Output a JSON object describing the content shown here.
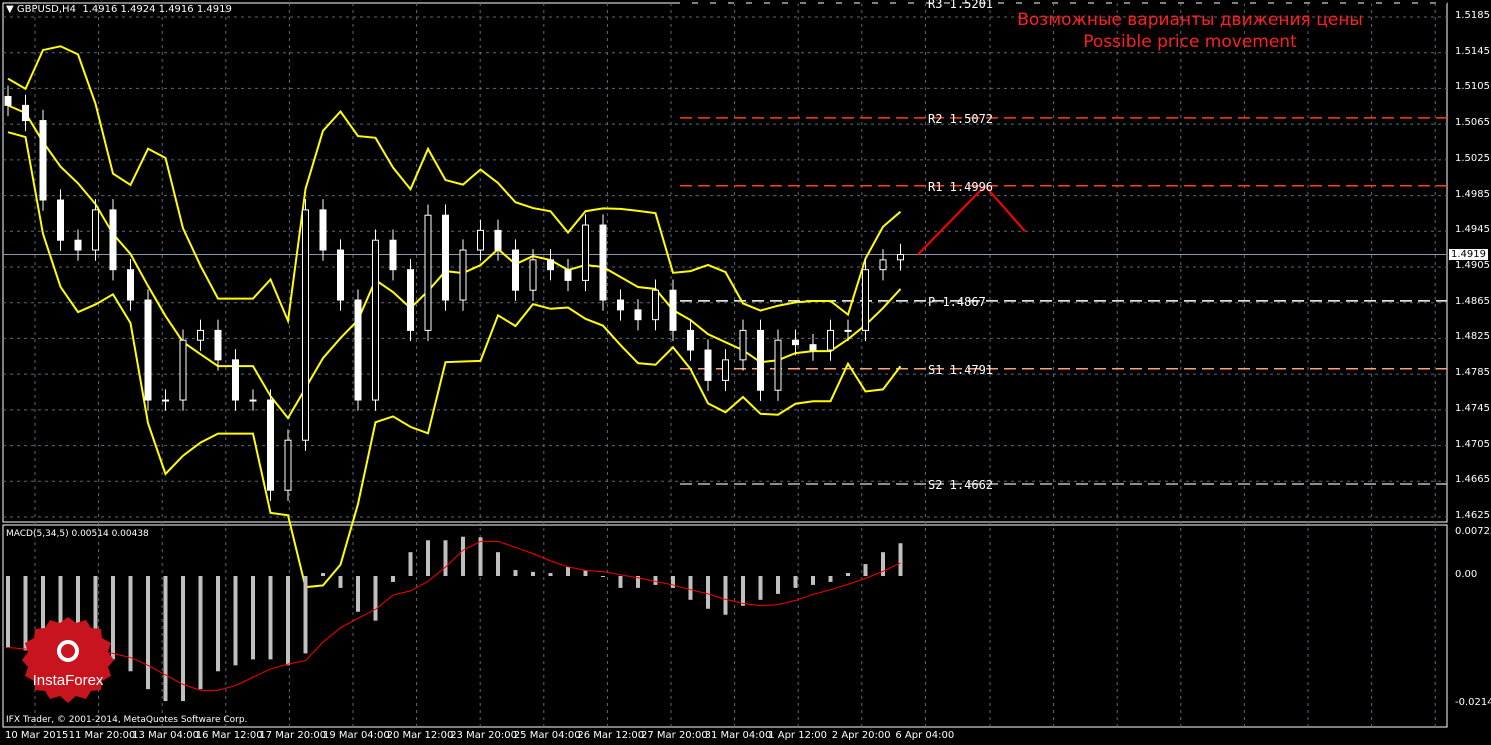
{
  "header": {
    "symbol_label": "GBPUSD,H4",
    "ohlc": "1.4916 1.4924 1.4916 1.4919"
  },
  "annotation": {
    "line1": "Возможные варианты движения цены",
    "line2": "Possible price movement"
  },
  "pivots": [
    {
      "label": "R3",
      "value": 1.5201,
      "text": "R3 1.5201",
      "color": "#000000"
    },
    {
      "label": "R2",
      "value": 1.5072,
      "text": "R2 1.5072",
      "color": "#ff4010"
    },
    {
      "label": "R1",
      "value": 1.4996,
      "text": "R1 1.4996",
      "color": "#ff4010"
    },
    {
      "label": "P",
      "value": 1.4867,
      "text": "P 1.4867",
      "color": "#ffffff"
    },
    {
      "label": "S1",
      "value": 1.4791,
      "text": "S1 1.4791",
      "color": "#ffa07a"
    },
    {
      "label": "S2",
      "value": 1.4662,
      "text": "S2 1.4662",
      "color": "#bbbbbb"
    }
  ],
  "current_price": "1.4919",
  "macd_label": "MACD(5,34,5) 0.00514 0.00438",
  "copyright": "IFX Trader, © 2001-2014, MetaQuotes Software Corp.",
  "logo_text": "InstaForex",
  "colors": {
    "bollinger": "#ffff00",
    "up": "#ffffff",
    "forecast": "#ff0000",
    "signal": "#ff0000",
    "hist": "#c0c0c0",
    "grid": "#5a6a78"
  },
  "chart_data": {
    "type": "candlestick",
    "title": "GBPUSD,H4",
    "price_ticks": [
      "1.5185",
      "1.5145",
      "1.5105",
      "1.5065",
      "1.5025",
      "1.4985",
      "1.4945",
      "1.4905",
      "1.4865",
      "1.4825",
      "1.4785",
      "1.4745",
      "1.4705",
      "1.4665",
      "1.4625"
    ],
    "ylim": [
      1.461,
      1.522
    ],
    "macd_ticks": [
      "0.00722",
      "0.00",
      "-0.02145"
    ],
    "macd_ylim": [
      -0.02145,
      0.00722
    ],
    "time_labels": [
      "10 Mar 2015",
      "11 Mar 20:00",
      "13 Mar 04:00",
      "16 Mar 12:00",
      "17 Mar 20:00",
      "19 Mar 04:00",
      "20 Mar 12:00",
      "23 Mar 20:00",
      "25 Mar 04:00",
      "26 Mar 12:00",
      "27 Mar 20:00",
      "31 Mar 04:00",
      "1 Apr 12:00",
      "2 Apr 20:00",
      "6 Apr 04:00"
    ],
    "closes": [
      1.5086,
      1.5069,
      1.498,
      1.4935,
      1.4924,
      1.4969,
      1.4902,
      1.4868,
      1.4756,
      1.4756,
      1.4823,
      1.4834,
      1.4801,
      1.4756,
      1.4756,
      1.4655,
      1.4711,
      1.4969,
      1.4924,
      1.4868,
      1.4756,
      1.4935,
      1.4902,
      1.4834,
      1.4963,
      1.4868,
      1.4924,
      1.4946,
      1.4924,
      1.4879,
      1.4913,
      1.4902,
      1.489,
      1.4952,
      1.4868,
      1.4857,
      1.4846,
      1.4879,
      1.4834,
      1.4812,
      1.4778,
      1.4801,
      1.4834,
      1.4767,
      1.4823,
      1.4818,
      1.4812,
      1.4834,
      1.4834,
      1.4902,
      1.4913,
      1.4919
    ],
    "macd_hist": [
      -0.012,
      -0.0125,
      -0.0125,
      -0.0125,
      -0.013,
      -0.013,
      -0.014,
      -0.016,
      -0.019,
      -0.021,
      -0.021,
      -0.019,
      -0.016,
      -0.015,
      -0.014,
      -0.014,
      -0.015,
      -0.013,
      0.0005,
      -0.002,
      -0.006,
      -0.0075,
      -0.001,
      0.004,
      0.006,
      0.006,
      0.0066,
      0.0065,
      0.004,
      0.001,
      0.0007,
      0.0005,
      0.0015,
      0.001,
      0,
      -0.002,
      -0.002,
      -0.0015,
      -0.002,
      -0.004,
      -0.0055,
      -0.0065,
      -0.005,
      -0.004,
      -0.003,
      -0.002,
      -0.0015,
      -0.001,
      0.0005,
      0.002,
      0.004,
      0.0055
    ],
    "forecast": [
      1.4919,
      1.4996,
      1.4945
    ]
  }
}
